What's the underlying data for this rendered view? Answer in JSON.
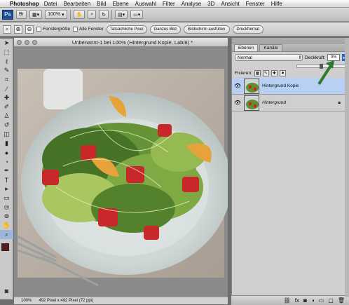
{
  "menubar": {
    "app": "Photoshop",
    "items": [
      "Datei",
      "Bearbeiten",
      "Bild",
      "Ebene",
      "Auswahl",
      "Filter",
      "Analyse",
      "3D",
      "Ansicht",
      "Fenster",
      "Hilfe"
    ]
  },
  "appbar": {
    "logo": "Ps",
    "br": "Br",
    "zoom": "100%"
  },
  "options": {
    "samples_all_windows": "Fenstergröße",
    "all_windows": "Alle Fenster",
    "actual_pixels": "Tatsächliche Pixel",
    "fit_screen": "Ganzes Bild",
    "fill_screen": "Bildschirm ausfüllen",
    "print_size": "Druckformat"
  },
  "document": {
    "title": "Unbenannt-1 bei 100% (Hintergrund Kopie, Lab/8) *",
    "zoom": "100%",
    "status": "492 Pixel x 492 Pixel (72 ppi)"
  },
  "panel": {
    "tabs": [
      "Ebenen",
      "Kanäle"
    ],
    "blend_mode": "Normal",
    "opacity_label": "Deckkraft:",
    "opacity_value": "0%",
    "lock_label": "Fixieren:",
    "layers": [
      {
        "name": "Hintergrund Kopie",
        "selected": true
      },
      {
        "name": "Hintergrund",
        "selected": false
      }
    ]
  },
  "colors": {
    "accent": "#1d4f91",
    "selection": "#b7d0f4",
    "arrow": "#2f7a2f"
  }
}
